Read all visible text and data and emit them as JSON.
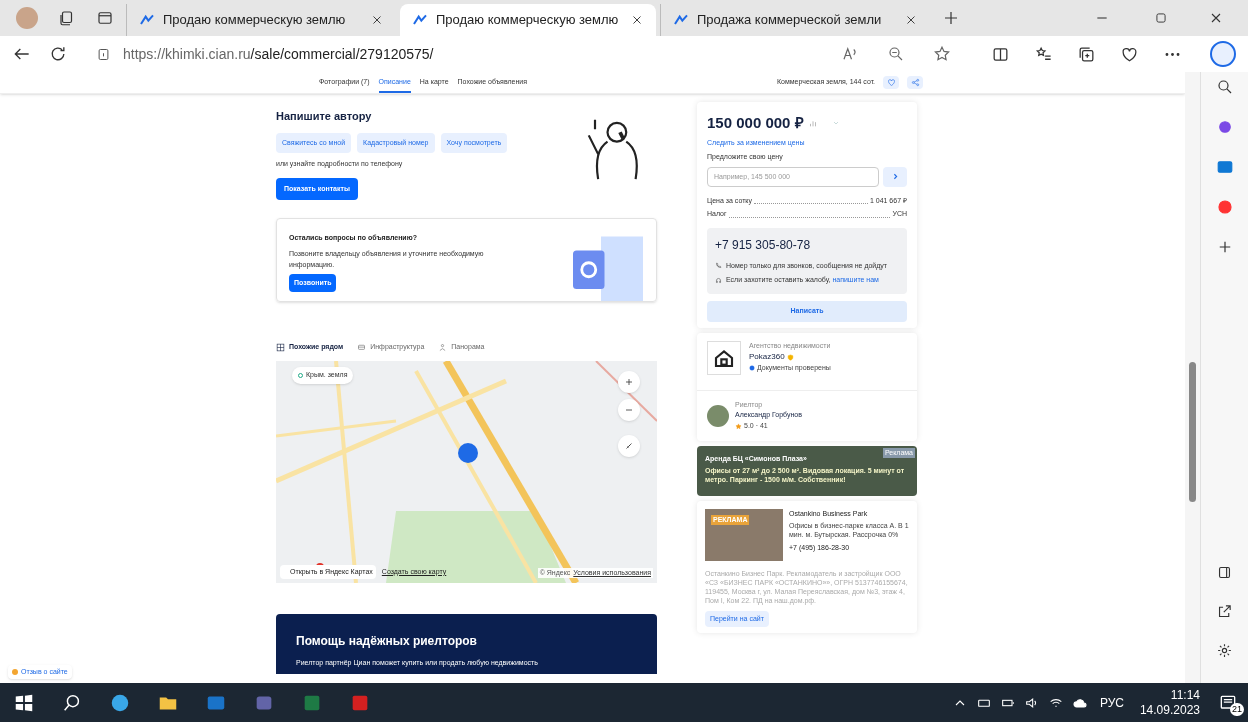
{
  "browser": {
    "tabs": [
      {
        "title": "Продаю коммерческую землю",
        "selected": false
      },
      {
        "title": "Продаю коммерческую землю",
        "selected": true
      },
      {
        "title": "Продажа коммерческой земли",
        "selected": false
      }
    ],
    "url_host": "https://khimki.cian.ru",
    "url_path": "/sale/commercial/279120575/"
  },
  "nav": {
    "links": [
      {
        "label": "Фотографии (7)",
        "selected": false
      },
      {
        "label": "Описание",
        "selected": true
      },
      {
        "label": "На карте",
        "selected": false
      },
      {
        "label": "Похожие объявления",
        "selected": false
      }
    ],
    "summary": "Коммерческая земля, 144 сот."
  },
  "contact": {
    "title": "Напишите автору",
    "quick_replies": [
      "Свяжитесь со мной",
      "Кадастровый номер",
      "Хочу посмотреть"
    ],
    "hint": "или узнайте подробности по телефону",
    "button": "Показать контакты"
  },
  "questions": {
    "title": "Остались вопросы по объявлению?",
    "text": "Позвоните владельцу объявления и уточните необходимую информацию.",
    "button": "Позвонить"
  },
  "map_tabs": [
    {
      "label": "Похожие рядом",
      "selected": true
    },
    {
      "label": "Инфраструктура",
      "selected": false
    },
    {
      "label": "Панорама",
      "selected": false
    }
  ],
  "map": {
    "chip": "Крым. земля",
    "open_link": "Открыть в Яндекс Картах",
    "create_link": "Создать свою карту",
    "copyright": "© Яндекс",
    "terms": "Условия использования"
  },
  "promo": {
    "title": "Помощь надёжных риелторов",
    "text": "Риелтор партнёр Циан поможет купить или продать любую недвижимость"
  },
  "price": {
    "amount": "150 000 000 ₽",
    "follow": "Следить за изменением цены",
    "offer_label": "Предложите свою цену",
    "offer_placeholder": "Например, 145 500 000",
    "rows": [
      {
        "label": "Цена за сотку",
        "value": "1 041 667 ₽"
      },
      {
        "label": "Налог",
        "value": "УСН"
      }
    ],
    "phone": "+7 915 305-80-78",
    "note": "Номер только для звонков, сообщения не дойдут",
    "complaint": "Если захотите оставить жалобу,",
    "complaint_link": "напишите нам",
    "write_button": "Написать"
  },
  "agency": {
    "kind": "Агентство недвижимости",
    "name": "Pokaz360",
    "verified": "Документы проверены"
  },
  "realtor": {
    "role": "Риелтор",
    "name": "Александр Горбунов",
    "rating": "5.0 · 41"
  },
  "ad_banner": {
    "badge": "Реклама",
    "title": "Аренда БЦ «Симонов Плаза»",
    "text": "Офисы от 27 м² до 2 500 м². Видовая локация. 5 минут от метро. Паркинг - 1500 м/м. Собственник!"
  },
  "ad_card": {
    "badge": "РЕКЛАМА",
    "title": "Ostankino Business Park",
    "text": "Офисы в бизнес-парке класса А. В 1 мин. м. Бутырская. Рассрочка 0%",
    "phone": "+7 (495) 186-28-30",
    "legal": "Останкино Бизнес Парк. Рекламодатель и застройщик ООО «СЗ «БИЗНЕС ПАРК «ОСТАНКИНО»», ОГРН 5137746155674, 119455, Москва г, ул. Малая Переяславская, дом №3, этаж 4, Пом I, Ком 22. ПД на наш.дом.рф.",
    "button": "Перейти на сайт"
  },
  "feedback": "Отзыв о сайте",
  "taskbar": {
    "language": "РУС",
    "time": "11:14",
    "date": "14.09.2023",
    "notifications": "21"
  }
}
